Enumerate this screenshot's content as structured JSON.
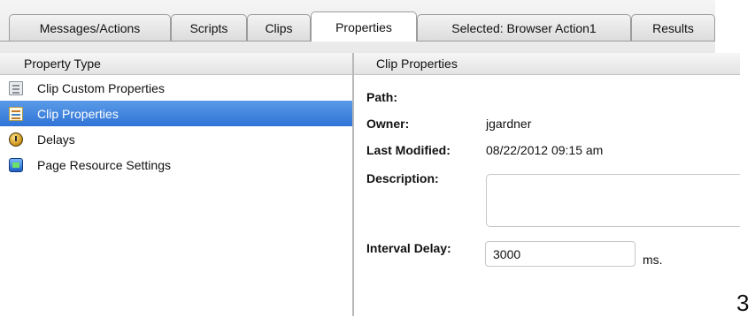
{
  "tabs": [
    {
      "label": "Messages/Actions"
    },
    {
      "label": "Scripts"
    },
    {
      "label": "Clips"
    },
    {
      "label": "Properties"
    },
    {
      "label": "Selected: Browser Action1"
    },
    {
      "label": "Results"
    }
  ],
  "active_tab": "Properties",
  "left_pane": {
    "header": "Property Type",
    "items": [
      {
        "label": "Clip Custom Properties",
        "icon": "document-icon",
        "selected": false
      },
      {
        "label": "Clip Properties",
        "icon": "note-list-icon",
        "selected": true
      },
      {
        "label": "Delays",
        "icon": "clock-icon",
        "selected": false
      },
      {
        "label": "Page Resource Settings",
        "icon": "page-resource-icon",
        "selected": false
      }
    ]
  },
  "right_pane": {
    "header": "Clip Properties",
    "path_label": "Path:",
    "path_value": "",
    "owner_label": "Owner:",
    "owner_value": "jgardner",
    "modified_label": "Last Modified:",
    "modified_value": "08/22/2012 09:15 am",
    "description_label": "Description:",
    "description_value": "",
    "interval_label": "Interval Delay:",
    "interval_value": "3000",
    "interval_unit": "ms."
  },
  "edge_char": "3",
  "colors": {
    "selection": "#2f73d6",
    "border": "#9c9c9c"
  }
}
